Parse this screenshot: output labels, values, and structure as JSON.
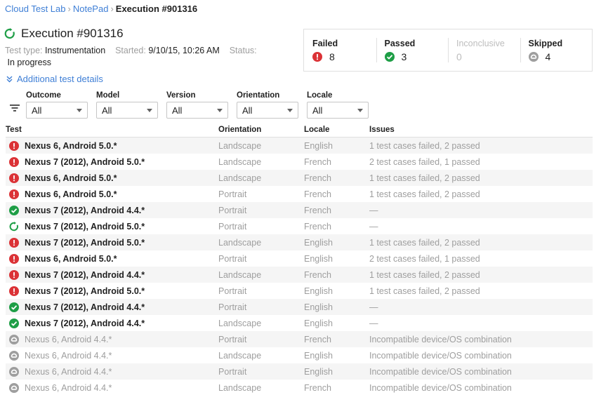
{
  "breadcrumb": {
    "items": [
      "Cloud Test Lab",
      "NotePad"
    ],
    "separator": "›",
    "current": "Execution #901316"
  },
  "execution": {
    "title": "Execution #901316",
    "test_type_label": "Test type:",
    "test_type": "Instrumentation",
    "started_label": "Started:",
    "started": "9/10/15, 10:26 AM",
    "status_label": "Status:",
    "status": "In progress"
  },
  "details_link": "Additional test details",
  "summary": {
    "failed": {
      "label": "Failed",
      "count": "8"
    },
    "passed": {
      "label": "Passed",
      "count": "3"
    },
    "inconclusive": {
      "label": "Inconclusive",
      "count": "0"
    },
    "skipped": {
      "label": "Skipped",
      "count": "4"
    }
  },
  "filters": [
    {
      "label": "Outcome",
      "value": "All"
    },
    {
      "label": "Model",
      "value": "All"
    },
    {
      "label": "Version",
      "value": "All"
    },
    {
      "label": "Orientation",
      "value": "All"
    },
    {
      "label": "Locale",
      "value": "All"
    }
  ],
  "table": {
    "headers": {
      "test": "Test",
      "orientation": "Orientation",
      "locale": "Locale",
      "issues": "Issues"
    },
    "rows": [
      {
        "status": "failed",
        "test": "Nexus 6, Android 5.0.*",
        "orientation": "Landscape",
        "locale": "English",
        "issues": "1 test cases failed, 2 passed"
      },
      {
        "status": "failed",
        "test": "Nexus 7 (2012), Android 5.0.*",
        "orientation": "Landscape",
        "locale": "French",
        "issues": "2 test cases failed, 1 passed"
      },
      {
        "status": "failed",
        "test": "Nexus 6, Android 5.0.*",
        "orientation": "Landscape",
        "locale": "French",
        "issues": "1 test cases failed, 2 passed"
      },
      {
        "status": "failed",
        "test": "Nexus 6, Android 5.0.*",
        "orientation": "Portrait",
        "locale": "French",
        "issues": "1 test cases failed, 2 passed"
      },
      {
        "status": "passed",
        "test": "Nexus 7 (2012), Android 4.4.*",
        "orientation": "Portrait",
        "locale": "French",
        "issues": "—"
      },
      {
        "status": "running",
        "test": "Nexus 7 (2012), Android 5.0.*",
        "orientation": "Portrait",
        "locale": "French",
        "issues": "—"
      },
      {
        "status": "failed",
        "test": "Nexus 7 (2012), Android 5.0.*",
        "orientation": "Landscape",
        "locale": "English",
        "issues": "1 test cases failed, 2 passed"
      },
      {
        "status": "failed",
        "test": "Nexus 6, Android 5.0.*",
        "orientation": "Portrait",
        "locale": "English",
        "issues": "2 test cases failed, 1 passed"
      },
      {
        "status": "failed",
        "test": "Nexus 7 (2012), Android 4.4.*",
        "orientation": "Landscape",
        "locale": "French",
        "issues": "1 test cases failed, 2 passed"
      },
      {
        "status": "failed",
        "test": "Nexus 7 (2012), Android 5.0.*",
        "orientation": "Portrait",
        "locale": "English",
        "issues": "1 test cases failed, 2 passed"
      },
      {
        "status": "passed",
        "test": "Nexus 7 (2012), Android 4.4.*",
        "orientation": "Portrait",
        "locale": "English",
        "issues": "—"
      },
      {
        "status": "passed",
        "test": "Nexus 7 (2012), Android 4.4.*",
        "orientation": "Landscape",
        "locale": "English",
        "issues": "—"
      },
      {
        "status": "skipped",
        "test": "Nexus 6, Android 4.4.*",
        "orientation": "Portrait",
        "locale": "French",
        "issues": "Incompatible device/OS combination"
      },
      {
        "status": "skipped",
        "test": "Nexus 6, Android 4.4.*",
        "orientation": "Landscape",
        "locale": "English",
        "issues": "Incompatible device/OS combination"
      },
      {
        "status": "skipped",
        "test": "Nexus 6, Android 4.4.*",
        "orientation": "Portrait",
        "locale": "English",
        "issues": "Incompatible device/OS combination"
      },
      {
        "status": "skipped",
        "test": "Nexus 6, Android 4.4.*",
        "orientation": "Landscape",
        "locale": "French",
        "issues": "Incompatible device/OS combination"
      }
    ]
  },
  "icons": {
    "failed": "error-icon",
    "passed": "check-circle-icon",
    "running": "in-progress-icon",
    "skipped": "skipped-icon",
    "filter": "filter-icon",
    "expand": "chevron-double-down-icon"
  },
  "colors": {
    "link": "#3f7fd6",
    "failed": "#db3236",
    "passed": "#1e9e46",
    "skipped": "#9e9e9e"
  }
}
